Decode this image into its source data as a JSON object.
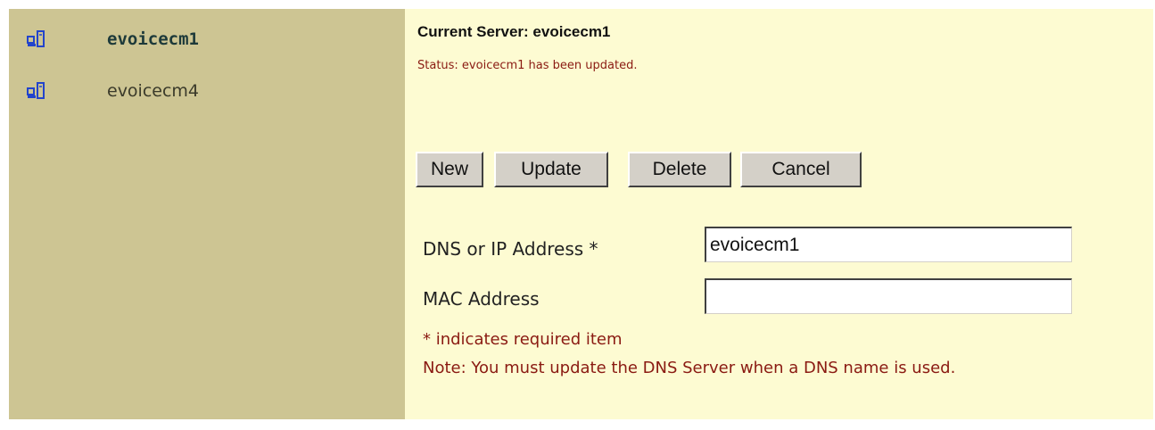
{
  "sidebar": {
    "servers": [
      {
        "name": "evoicecm1",
        "selected": true,
        "icon": "server-icon"
      },
      {
        "name": "evoicecm4",
        "selected": false,
        "icon": "server-icon"
      }
    ]
  },
  "main": {
    "current_server": "Current Server: evoicecm1",
    "status": "Status:  evoicecm1 has been updated."
  },
  "toolbar": {
    "new_label": "New",
    "update_label": "Update",
    "delete_label": "Delete",
    "cancel_label": "Cancel"
  },
  "form": {
    "dns_label": "DNS or IP Address *",
    "dns_value": "evoicecm1",
    "mac_label": "MAC Address",
    "mac_value": "",
    "required_note": "* indicates required item",
    "dns_note": "Note: You must update the DNS Server when a DNS name is used."
  },
  "colors": {
    "sidebar_bg": "#cdc593",
    "main_bg": "#fdfbd2",
    "note_text": "#8a1a12",
    "icon_blue": "#2244cc"
  }
}
